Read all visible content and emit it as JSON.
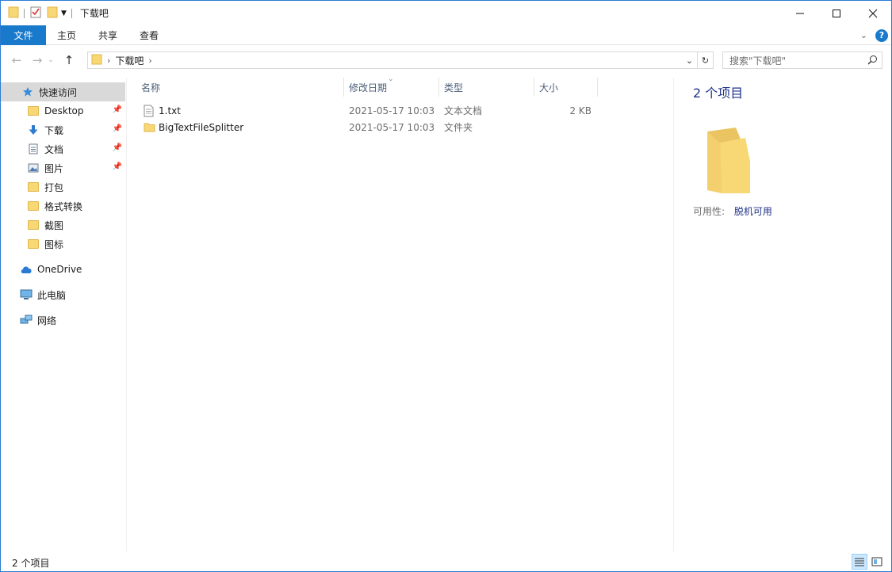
{
  "window": {
    "title": "下载吧",
    "minimize_icon": "minimize-icon",
    "maximize_icon": "maximize-icon",
    "close_icon": "close-icon"
  },
  "ribbon": {
    "tabs": [
      "文件",
      "主页",
      "共享",
      "查看"
    ]
  },
  "address": {
    "crumbs": [
      "下载吧"
    ]
  },
  "search": {
    "placeholder": "搜索\"下载吧\""
  },
  "nav": {
    "quick_access": "快速访问",
    "pinned": [
      {
        "label": "Desktop",
        "icon": "folder-icon",
        "pinned": true
      },
      {
        "label": "下载",
        "icon": "download-icon",
        "pinned": true
      },
      {
        "label": "文档",
        "icon": "document-icon",
        "pinned": true
      },
      {
        "label": "图片",
        "icon": "pictures-icon",
        "pinned": true
      },
      {
        "label": "打包",
        "icon": "folder-icon",
        "pinned": false
      },
      {
        "label": "格式转换",
        "icon": "folder-icon",
        "pinned": false
      },
      {
        "label": "截图",
        "icon": "folder-icon",
        "pinned": false
      },
      {
        "label": "图标",
        "icon": "folder-icon",
        "pinned": false
      }
    ],
    "onedrive": "OneDrive",
    "this_pc": "此电脑",
    "network": "网络"
  },
  "columns": {
    "name": "名称",
    "modified": "修改日期",
    "type": "类型",
    "size": "大小"
  },
  "files": [
    {
      "name": "1.txt",
      "modified": "2021-05-17 10:03",
      "type": "文本文档",
      "size": "2 KB",
      "icon": "text-file-icon"
    },
    {
      "name": "BigTextFileSplitter",
      "modified": "2021-05-17 10:03",
      "type": "文件夹",
      "size": "",
      "icon": "folder-icon"
    }
  ],
  "preview": {
    "title": "2 个项目",
    "availability_label": "可用性:",
    "availability_value": "脱机可用"
  },
  "status": {
    "count": "2 个项目"
  }
}
